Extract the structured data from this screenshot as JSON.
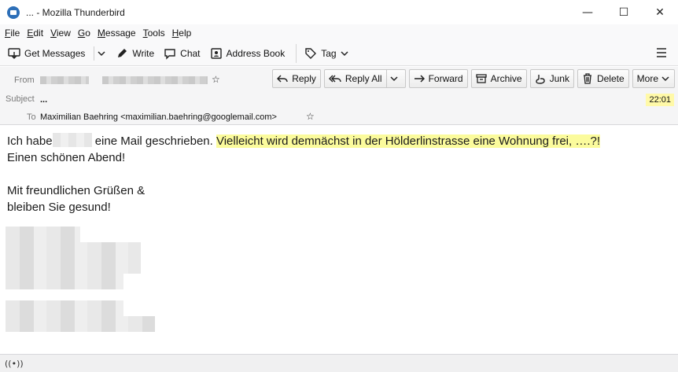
{
  "window": {
    "title": "... - Mozilla Thunderbird",
    "minimize_glyph": "—",
    "maximize_glyph": "☐",
    "close_glyph": "✕"
  },
  "menu": {
    "items": [
      {
        "first": "F",
        "rest": "ile"
      },
      {
        "first": "E",
        "rest": "dit"
      },
      {
        "first": "V",
        "rest": "iew"
      },
      {
        "first": "G",
        "rest": "o"
      },
      {
        "first": "M",
        "rest": "essage"
      },
      {
        "first": "T",
        "rest": "ools"
      },
      {
        "first": "H",
        "rest": "elp"
      }
    ]
  },
  "toolbar": {
    "get_messages": "Get Messages",
    "write": "Write",
    "chat": "Chat",
    "address_book": "Address Book",
    "tag": "Tag"
  },
  "header": {
    "from_label": "From",
    "subject_label": "Subject",
    "subject_value": "...",
    "to_label": "To",
    "to_value": "Maximilian Baehring <maximilian.baehring@googlemail.com>",
    "time": "22:01"
  },
  "actions": {
    "reply": "Reply",
    "reply_all": "Reply All",
    "forward": "Forward",
    "archive": "Archive",
    "junk": "Junk",
    "delete": "Delete",
    "more": "More"
  },
  "message": {
    "line1_start": "Ich habe",
    "line1_mid": " eine Mail geschrieben. ",
    "line1_highlight": "Vielleicht wird demnächst in der Hölderlinstrasse eine Wohnung frei, ….?!",
    "line2": "Einen schönen Abend!",
    "greeting1": "Mit freundlichen Grüßen &",
    "greeting2": "bleiben Sie gesund!"
  },
  "status": {
    "icon": "activity-icon",
    "glyph": "((•))"
  },
  "colors": {
    "highlight": "#fbfb9c",
    "time_badge": "#fff9a8",
    "app_icon": "#2d6fb8"
  }
}
